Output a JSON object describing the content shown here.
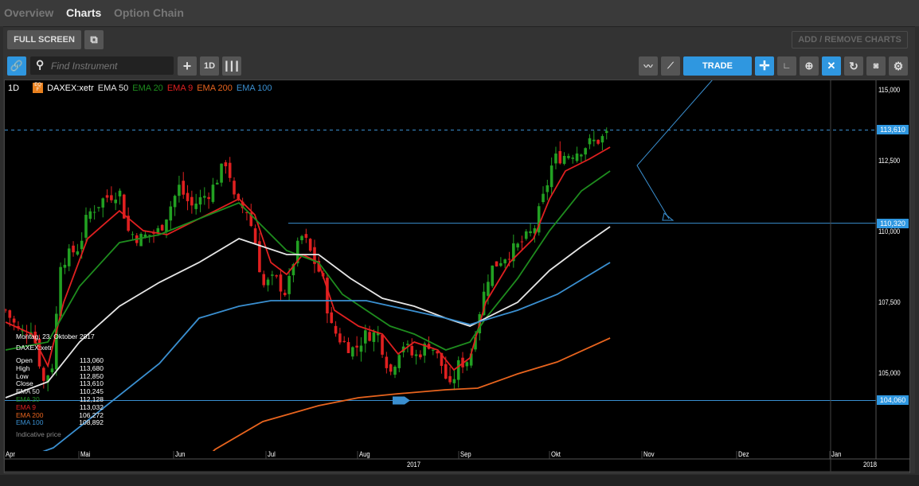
{
  "tabs": [
    {
      "label": "Overview"
    },
    {
      "label": "Charts"
    },
    {
      "label": "Option Chain"
    }
  ],
  "toolbar": {
    "full_screen": "FULL SCREEN",
    "add_remove": "ADD / REMOVE CHARTS",
    "search_placeholder": "Find Instrument",
    "interval": "1D",
    "trade": "TRADE"
  },
  "legend": {
    "interval": "1D",
    "badge": "EQ F",
    "instrument": "DAXEX:xetr",
    "items": [
      {
        "label": "EMA 50",
        "color": "#e6e6e6"
      },
      {
        "label": "EMA 20",
        "color": "#1e8c1e"
      },
      {
        "label": "EMA 9",
        "color": "#e02020"
      },
      {
        "label": "EMA 200",
        "color": "#e8641e"
      },
      {
        "label": "EMA 100",
        "color": "#3a8fd0"
      }
    ]
  },
  "info": {
    "date": "Montag, 23. Oktober 2017",
    "instrument": "DAXEX:xetr",
    "rows": [
      {
        "label": "Open",
        "value": "113,060",
        "color": "#ffffff"
      },
      {
        "label": "High",
        "value": "113,680",
        "color": "#ffffff"
      },
      {
        "label": "Low",
        "value": "112,850",
        "color": "#ffffff"
      },
      {
        "label": "Close",
        "value": "113,610",
        "color": "#ffffff"
      },
      {
        "label": "EMA 50",
        "value": "110,245",
        "color": "#e6e6e6"
      },
      {
        "label": "EMA 20",
        "value": "112,128",
        "color": "#1e8c1e"
      },
      {
        "label": "EMA 9",
        "value": "113,032",
        "color": "#e02020"
      },
      {
        "label": "EMA 200",
        "value": "106,272",
        "color": "#e8641e"
      },
      {
        "label": "EMA 100",
        "value": "108,892",
        "color": "#3a8fd0"
      }
    ],
    "note": "Indicative price"
  },
  "chart_data": {
    "type": "candlestick",
    "x_unit": "days since 2017-04-01",
    "ylim": [
      101800,
      115400
    ],
    "y_ticks": [
      "115,000",
      "112,500",
      "110,000",
      "107,500",
      "105,000"
    ],
    "y_tick_values": [
      115000,
      112500,
      110000,
      107500,
      105000
    ],
    "x_ticks": [
      "Apr",
      "Mai",
      "Jun",
      "Jul",
      "Aug",
      "Sep",
      "Okt",
      "Nov",
      "Dez",
      "Jan"
    ],
    "year_labels": [
      "2017",
      "2018"
    ],
    "price_tags": [
      {
        "label": "113,610",
        "value": 113610
      },
      {
        "label": "110,320",
        "value": 110320
      },
      {
        "label": "104,060",
        "value": 104060
      }
    ],
    "close_path": [
      [
        0,
        107247
      ],
      [
        5,
        106400
      ],
      [
        8.8,
        106685
      ],
      [
        12.8,
        104719
      ],
      [
        16,
        105400
      ],
      [
        18.2,
        108933
      ],
      [
        24.8,
        109500
      ],
      [
        27.5,
        110618
      ],
      [
        32.9,
        111180
      ],
      [
        38.2,
        111461
      ],
      [
        40.9,
        110056
      ],
      [
        44.9,
        109775
      ],
      [
        51.6,
        110056
      ],
      [
        58.2,
        111601
      ],
      [
        62.2,
        110900
      ],
      [
        68.9,
        111461
      ],
      [
        74.3,
        112584
      ],
      [
        76.9,
        111039
      ],
      [
        81,
        110758
      ],
      [
        83.6,
        109775
      ],
      [
        86.3,
        108090
      ],
      [
        90.3,
        108371
      ],
      [
        94.3,
        107809
      ],
      [
        97,
        109213
      ],
      [
        99.7,
        109916
      ],
      [
        103.7,
        108933
      ],
      [
        106.3,
        108371
      ],
      [
        109,
        106685
      ],
      [
        113,
        106124
      ],
      [
        117,
        105843
      ],
      [
        121,
        106405
      ],
      [
        125,
        106405
      ],
      [
        129,
        105000
      ],
      [
        133,
        106124
      ],
      [
        137.1,
        105562
      ],
      [
        142.4,
        106124
      ],
      [
        146.4,
        105281
      ],
      [
        149,
        104438
      ],
      [
        151.7,
        105281
      ],
      [
        155.8,
        105562
      ],
      [
        158.4,
        106967
      ],
      [
        162.4,
        108652
      ],
      [
        166.4,
        109073
      ],
      [
        171.8,
        109494
      ],
      [
        177.1,
        110056
      ],
      [
        181.1,
        111461
      ],
      [
        183.8,
        112584
      ],
      [
        187.8,
        112725
      ],
      [
        191.8,
        112865
      ],
      [
        195.8,
        113146
      ],
      [
        199.8,
        113286
      ],
      [
        203,
        113610
      ]
    ],
    "series": [
      {
        "name": "EMA 9",
        "color": "#e02020",
        "points": [
          [
            0,
            106826
          ],
          [
            8.8,
            106405
          ],
          [
            14.2,
            105281
          ],
          [
            19.5,
            107528
          ],
          [
            27.5,
            109775
          ],
          [
            38.2,
            110758
          ],
          [
            46.2,
            110056
          ],
          [
            54.2,
            109916
          ],
          [
            62.2,
            110337
          ],
          [
            70.3,
            110758
          ],
          [
            78.3,
            111180
          ],
          [
            83.6,
            110618
          ],
          [
            89,
            108933
          ],
          [
            94.3,
            108511
          ],
          [
            99.7,
            109213
          ],
          [
            105,
            108933
          ],
          [
            110.3,
            107247
          ],
          [
            118.4,
            106685
          ],
          [
            126.4,
            106405
          ],
          [
            131.7,
            105702
          ],
          [
            137.1,
            106124
          ],
          [
            145,
            105843
          ],
          [
            150.4,
            105140
          ],
          [
            155.8,
            105562
          ],
          [
            161.1,
            107528
          ],
          [
            169.1,
            108933
          ],
          [
            177.1,
            109775
          ],
          [
            182.5,
            111180
          ],
          [
            187.8,
            112163
          ],
          [
            195.8,
            112584
          ],
          [
            202.8,
            113006
          ]
        ]
      },
      {
        "name": "EMA 20",
        "color": "#1e8c1e",
        "points": [
          [
            0,
            105843
          ],
          [
            14.2,
            106124
          ],
          [
            24.8,
            108090
          ],
          [
            38.2,
            109635
          ],
          [
            51.6,
            109916
          ],
          [
            64.9,
            110477
          ],
          [
            78.3,
            111039
          ],
          [
            86.3,
            110197
          ],
          [
            94.3,
            109354
          ],
          [
            105,
            108933
          ],
          [
            113,
            107809
          ],
          [
            121,
            107247
          ],
          [
            129,
            106685
          ],
          [
            137.1,
            106405
          ],
          [
            147.7,
            105843
          ],
          [
            155.8,
            106124
          ],
          [
            161.1,
            106967
          ],
          [
            171.8,
            108371
          ],
          [
            182.5,
            110056
          ],
          [
            193.2,
            111461
          ],
          [
            202.8,
            112163
          ]
        ]
      },
      {
        "name": "EMA 50",
        "color": "#e6e6e6",
        "points": [
          [
            0,
            104157
          ],
          [
            14.2,
            104719
          ],
          [
            24.8,
            106124
          ],
          [
            38.2,
            107388
          ],
          [
            51.6,
            108230
          ],
          [
            64.9,
            108933
          ],
          [
            78.3,
            109775
          ],
          [
            86.3,
            109494
          ],
          [
            94.3,
            109213
          ],
          [
            105,
            109213
          ],
          [
            115.7,
            108371
          ],
          [
            126.4,
            107669
          ],
          [
            137.1,
            107388
          ],
          [
            147.7,
            106967
          ],
          [
            155.8,
            106685
          ],
          [
            161.1,
            106967
          ],
          [
            171.8,
            107528
          ],
          [
            182.5,
            108652
          ],
          [
            193.2,
            109494
          ],
          [
            202.8,
            110197
          ]
        ]
      },
      {
        "name": "EMA 100",
        "color": "#3a8fd0",
        "points": [
          [
            -2,
            101700
          ],
          [
            16,
            102387
          ],
          [
            51.6,
            105365
          ],
          [
            64.9,
            106967
          ],
          [
            78.3,
            107388
          ],
          [
            89,
            107584
          ],
          [
            121,
            107584
          ],
          [
            147.7,
            106967
          ],
          [
            155.8,
            106742
          ],
          [
            171.8,
            107247
          ],
          [
            185.1,
            107809
          ],
          [
            202.8,
            108933
          ]
        ]
      },
      {
        "name": "EMA 200",
        "color": "#e8641e",
        "points": [
          [
            66,
            101900
          ],
          [
            70.3,
            102331
          ],
          [
            86.3,
            103314
          ],
          [
            105,
            103876
          ],
          [
            118.4,
            104157
          ],
          [
            131.7,
            104297
          ],
          [
            147.7,
            104438
          ],
          [
            158.4,
            104494
          ],
          [
            171.8,
            105000
          ],
          [
            185.1,
            105421
          ],
          [
            202.8,
            106264
          ]
        ]
      }
    ]
  }
}
